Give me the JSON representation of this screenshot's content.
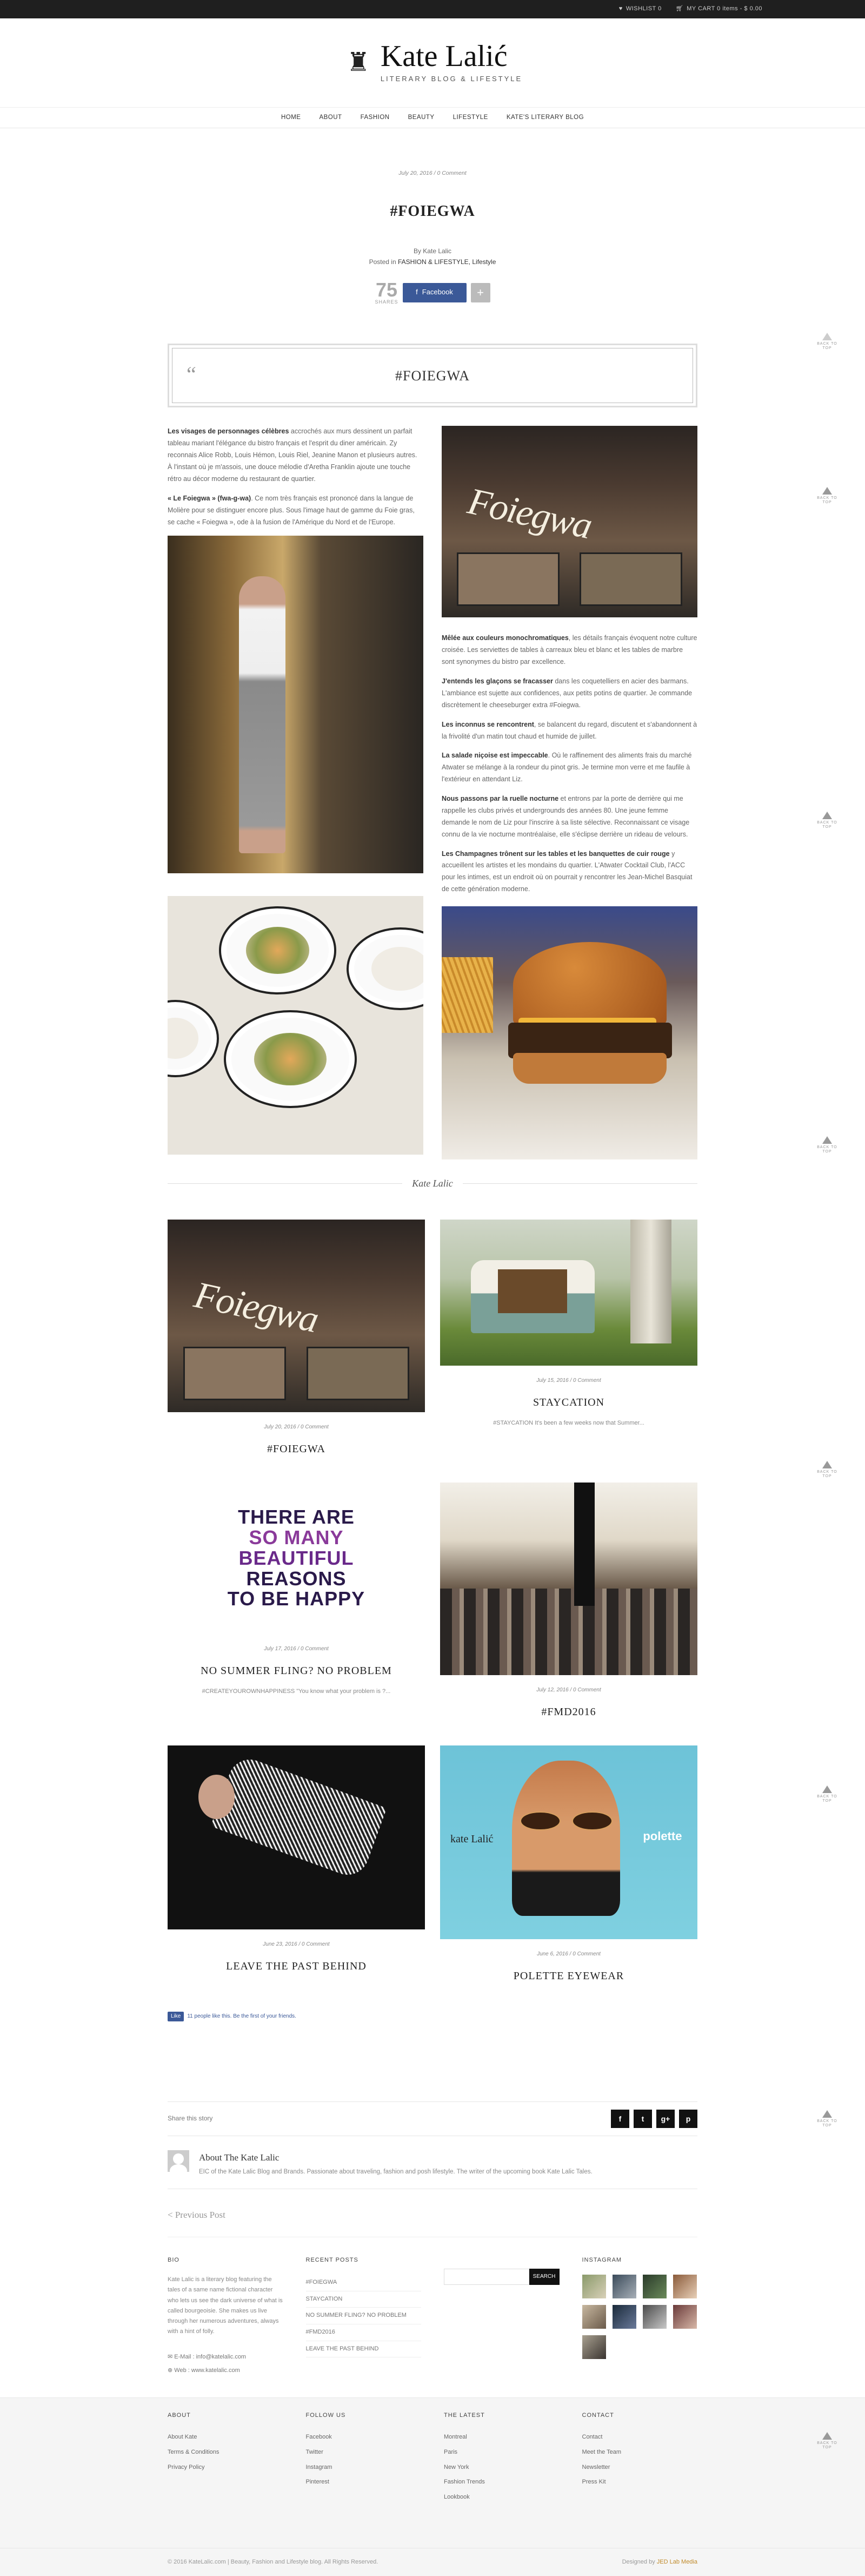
{
  "topbar": {
    "wishlist": "WISHLIST 0",
    "cart": "MY CART 0 items - $ 0.00"
  },
  "brand": {
    "name": "Kate Lalić",
    "tagline": "LITERARY BLOG & LIFESTYLE"
  },
  "nav": [
    "HOME",
    "ABOUT",
    "FASHION",
    "BEAUTY",
    "LIFESTYLE",
    "KATE'S LITERARY BLOG"
  ],
  "post": {
    "date": "July 20, 2016 / 0 Comment",
    "title": "#FOIEGWA",
    "by": "By Kate Lalic",
    "posted_prefix": "Posted in",
    "categories": "FASHION & LIFESTYLE, Lifestyle",
    "shares_count": "75",
    "shares_label": "SHARES",
    "facebook": "Facebook",
    "plus": "+",
    "quote_title": "#FOIEGWA",
    "left_paragraphs": [
      {
        "strong": "Les visages de personnages célèbres",
        "text": " accrochés aux murs dessinent un parfait tableau mariant l'élégance du bistro français et l'esprit du diner américain. Zy reconnais Alice Robb, Louis Hémon, Louis Riel, Jeanine Manon et plusieurs autres. À l'instant où je m'assois, une douce mélodie d'Aretha Franklin ajoute une touche rétro au décor moderne du restaurant de quartier."
      },
      {
        "strong": "« Le Foiegwa » (fwa-g-wa)",
        "text": ". Ce nom très français est prononcé dans la langue de Molière pour se distinguer encore plus. Sous l'image haut de gamme du Foie gras, se cache « Foiegwa », ode à la fusion de l'Amérique du Nord et de l'Europe."
      }
    ],
    "right_paragraphs": [
      {
        "strong": "Mêlée aux couleurs monochromatiques",
        "text": ", les détails français évoquent notre culture croisée. Les serviettes de tables à carreaux bleu et blanc et les tables de marbre sont synonymes du bistro par excellence."
      },
      {
        "strong": "J'entends les glaçons se fracasser",
        "text": " dans les coquetelliers en acier des barmans. L'ambiance est sujette aux confidences, aux petits potins de quartier. Je commande discrètement le cheeseburger extra #Foiegwa."
      },
      {
        "strong": "Les inconnus se rencontrent",
        "text": ", se balancent du regard, discutent et s'abandonnent à la frivolité d'un matin tout chaud et humide de juillet."
      },
      {
        "strong": "La salade niçoise est impeccable",
        "text": ". Où le raffinement des aliments frais du marché Atwater se mélange à la rondeur du pinot gris. Je termine mon verre et me faufile à l'extérieur en attendant Liz."
      },
      {
        "strong": "Nous passons par la ruelle nocturne",
        "text": " et entrons par la porte de derrière qui me rappelle les clubs privés et undergrounds des années 80. Une jeune femme demande le nom de Liz pour l'inscrire à sa liste sélective. Reconnaissant ce visage connu de la vie nocturne montréalaise, elle s'éclipse derrière un rideau de velours."
      },
      {
        "strong": "Les Champagnes trônent sur les tables et les banquettes de cuir rouge",
        "text": " y accueillent les artistes et les mondains du quartier. L'Atwater Cocktail Club, l'ACC pour les intimes, est un endroit où on pourrait y rencontrer les Jean-Michel Basquiat de cette génération moderne."
      }
    ],
    "signature": "Kate Lalic"
  },
  "related": [
    {
      "date": "July 20, 2016 / 0 Comment",
      "title": "#FOIEGWA",
      "excerpt": ""
    },
    {
      "date": "July 15, 2016 / 0 Comment",
      "title": "STAYCATION",
      "excerpt": "#STAYCATION   It's been a few weeks now that Summer..."
    },
    {
      "date": "July 17, 2016 / 0 Comment",
      "title": "NO SUMMER FLING? NO PROBLEM",
      "excerpt": "#CREATEYOUROWNHAPPINESS       \"You know what your problem is ?..."
    },
    {
      "date": "July 12, 2016 / 0 Comment",
      "title": "#FMD2016",
      "excerpt": ""
    },
    {
      "date": "June 23, 2016 / 0 Comment",
      "title": "LEAVE THE PAST BEHIND",
      "excerpt": ""
    },
    {
      "date": "June 6, 2016 / 0 Comment",
      "title": "POLETTE EYEWEAR",
      "excerpt": ""
    }
  ],
  "happy_image_lines": [
    "THERE ARE",
    "SO MANY",
    "BEAUTIFUL",
    "REASONS",
    "TO BE HAPPY"
  ],
  "polette_image": {
    "left": "kate Lalić",
    "right": "polette"
  },
  "fb_like": {
    "button": "Like",
    "text": "11 people like this. Be the first of your friends."
  },
  "share_story": "Share this story",
  "socials": [
    "f",
    "t",
    "g+",
    "p"
  ],
  "author": {
    "name": "About The Kate Lalic",
    "bio": "EIC of the Kate Lalic Blog and Brands. Passionate about traveling, fashion and posh lifestyle. The writer of the upcoming book Kate Lalic Tales."
  },
  "prev_post": "< Previous Post",
  "widgets": {
    "bio_title": "BIO",
    "bio_text": "Kate Lalic is a literary blog featuring the tales of a same name fictional character who lets us see the dark universe of what is called bourgeoisie. She makes us live through her numerous adventures, always with a hint of folly.",
    "email": "E-Mail : info@katelalic.com",
    "web": "Web : www.katelalic.com",
    "recent_title": "RECENT POSTS",
    "recent": [
      "#FOIEGWA",
      "STAYCATION",
      "NO SUMMER FLING? NO PROBLEM",
      "#FMD2016",
      "LEAVE THE PAST BEHIND"
    ],
    "search_button": "SEARCH",
    "search_placeholder": "",
    "insta_title": "INSTAGRAM"
  },
  "footer": {
    "cols": [
      {
        "title": "ABOUT",
        "items": [
          "About Kate",
          "Terms & Conditions",
          "Privacy Policy"
        ]
      },
      {
        "title": "FOLLOW US",
        "items": [
          "Facebook",
          "Twitter",
          "Instagram",
          "Pinterest"
        ]
      },
      {
        "title": "THE LATEST",
        "items": [
          "Montreal",
          "Paris",
          "New York",
          "Fashion Trends",
          "Lookbook"
        ]
      },
      {
        "title": "CONTACT",
        "items": [
          "Contact",
          "Meet the Team",
          "Newsletter",
          "Press Kit"
        ]
      }
    ],
    "copyright": "© 2016 KateLalic.com  |  Beauty, Fashion and Lifestyle blog. All Rights Reserved.",
    "designed_prefix": "Designed by",
    "designer": "JED Lab Media"
  },
  "back_to_top": "BACK TO TOP",
  "colors": {
    "accent": "#3b5998",
    "happy_purple": "#8a3a9a",
    "happy_dark": "#2a1a4a",
    "designer": "#c08a2a"
  }
}
